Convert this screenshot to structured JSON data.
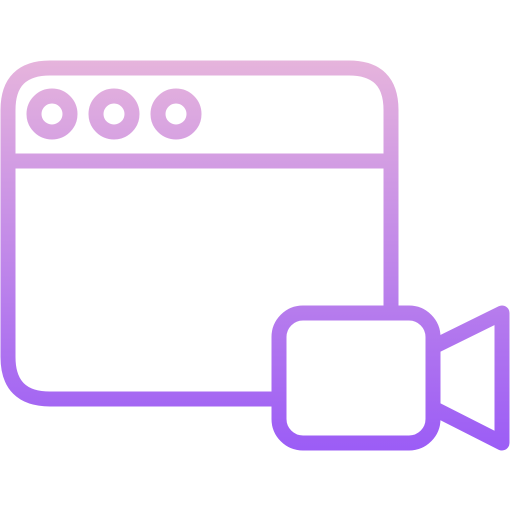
{
  "icon": {
    "name": "browser-video-icon",
    "colors": {
      "gradient_top": "#E6B4DC",
      "gradient_bottom": "#9B5CF6",
      "background": "#FFFFFF"
    },
    "parts": {
      "window": "browser-window",
      "title_bar_dots": 3,
      "camera": "video-camera"
    }
  }
}
